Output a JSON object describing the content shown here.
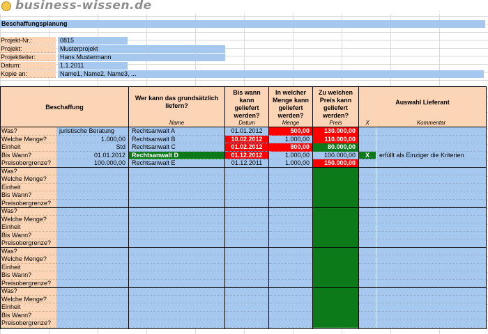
{
  "logo": {
    "text": "business-wissen.de",
    "icon": "smiley-icon"
  },
  "title": "Beschaffungsplanung",
  "project": [
    {
      "label": "Projekt-Nr.:",
      "value": "0815"
    },
    {
      "label": "Projekt:",
      "value": "Musterprojekt"
    },
    {
      "label": "Projektleiter:",
      "value": "Hans Mustermann"
    },
    {
      "label": "Datum:",
      "value": "1.1.2011"
    },
    {
      "label": "Kopie an:",
      "value": "Name1, Name2, Name3, ..."
    }
  ],
  "headers": {
    "beschaffung": "Beschaffung",
    "wer": "Wer kann das grundsätzlich liefern?",
    "bis_wann": "Bis wann kann geliefert werden?",
    "menge": "In welcher Menge kann geliefert werden?",
    "preis": "Zu welchen Preis kann geliefert werden?",
    "auswahl": "Auswahl Lieferant",
    "sub_name": "Name",
    "sub_datum": "Datum",
    "sub_menge": "Menge",
    "sub_preis": "Preis",
    "sub_x": "X",
    "sub_kommentar": "Kommentar"
  },
  "row_labels": [
    "Was?",
    "Welche Menge?",
    "Einheit",
    "Bis Wann?",
    "Preisobergrenze?"
  ],
  "first_group": {
    "values": [
      "juristische Beratung",
      "1.000,00",
      "Std",
      "01.01.2012",
      "100.000,00"
    ],
    "suppliers": [
      {
        "name": "Rechtsanwalt A",
        "datum": "01.01.2012",
        "menge": "500,00",
        "preis": "130.000,00",
        "x": "",
        "kommentar": ""
      },
      {
        "name": "Rechtsanwalt B",
        "datum": "10.02.2012",
        "menge": "1.000,00",
        "preis": "110.000,00",
        "x": "",
        "kommentar": ""
      },
      {
        "name": "Rechtsanwalt C",
        "datum": "01.02.2012",
        "menge": "800,00",
        "preis": "80.000,00",
        "x": "",
        "kommentar": ""
      },
      {
        "name": "Rechtsanwalt D",
        "datum": "01.12.2012",
        "menge": "1.000,00",
        "preis": "100.000,00",
        "x": "X",
        "kommentar": "erfüllt als Einziger die Kriterien"
      },
      {
        "name": "Rechtsanwalt E",
        "datum": "01.12.2011",
        "menge": "1.000,00",
        "preis": "150.000,00",
        "x": "",
        "kommentar": ""
      }
    ]
  },
  "colors": {
    "blue": "#a6c8ef",
    "peach": "#fbd5b5",
    "red": "#ff0000",
    "green": "#0d7a1a"
  }
}
